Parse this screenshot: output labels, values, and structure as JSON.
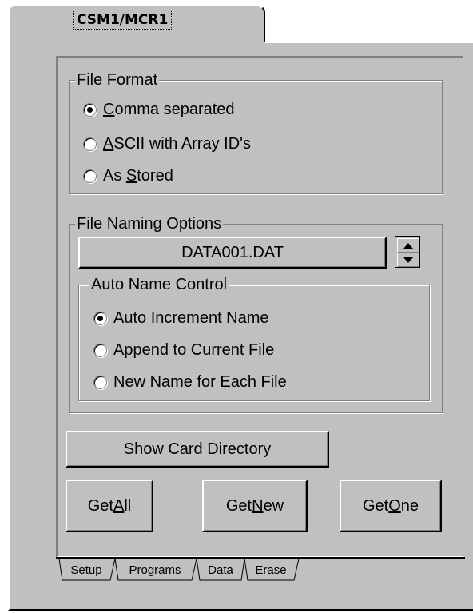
{
  "top_tab": {
    "label": "CSM1/MCR1"
  },
  "file_format": {
    "title": "File Format",
    "options": [
      {
        "pre": "",
        "key": "C",
        "post": "omma separated",
        "selected": true
      },
      {
        "pre": "",
        "key": "A",
        "post": "SCII with Array ID's",
        "selected": false
      },
      {
        "pre": "As ",
        "key": "S",
        "post": "tored",
        "selected": false
      }
    ]
  },
  "file_naming": {
    "title": "File Naming Options",
    "filename": "DATA001.DAT",
    "auto_name": {
      "title": "Auto Name Control",
      "options": [
        {
          "label": "Auto Increment Name",
          "selected": true
        },
        {
          "label": "Append to Current File",
          "selected": false
        },
        {
          "label": "New Name for Each File",
          "selected": false
        }
      ]
    }
  },
  "buttons": {
    "show_card_directory": "Show Card Directory",
    "get_all": {
      "pre": "Get ",
      "key": "A",
      "post": "ll"
    },
    "get_new": {
      "pre": "Get ",
      "key": "N",
      "post": "ew"
    },
    "get_one": {
      "pre": "Get ",
      "key": "O",
      "post": "ne"
    }
  },
  "bottom_tabs": [
    "Setup",
    "Programs",
    "Data",
    "Erase"
  ],
  "active_bottom_tab": "Data"
}
